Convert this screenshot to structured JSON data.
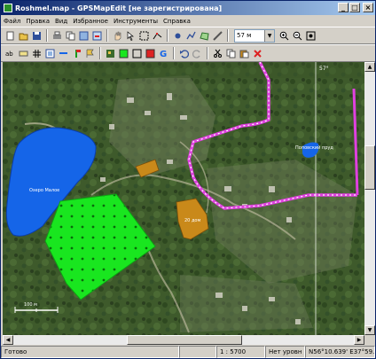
{
  "window": {
    "title": "Roshmel.map - GPSMapEdit [не зарегистрирована]"
  },
  "titlebar_buttons": {
    "minimize": "_",
    "maximize": "□",
    "close": "×"
  },
  "menu": [
    "Файл",
    "Правка",
    "Вид",
    "Избранное",
    "Инструменты",
    "Справка"
  ],
  "toolbar": {
    "zoom_value": "57 м"
  },
  "map": {
    "labels": {
      "lake_west": "Озеро Малое",
      "lake_east": "Поповский пруд",
      "parcel": "20 дом",
      "grid_label": "57°",
      "scale": "100 м"
    }
  },
  "status": {
    "ready": "Готово",
    "scale": "1 : 5700",
    "level": "Нет уровн",
    "coords": "N56°10.639' E37°59.108'"
  },
  "colors": {
    "title_start": "#0a246a",
    "lake": "#1565e8",
    "grid_polygon": "#19e61f",
    "parcel": "#c9891a",
    "track": "#e040e0"
  },
  "icons": [
    "new-icon",
    "open-icon",
    "save-icon",
    "print-icon",
    "copy-map-icon",
    "import-icon",
    "export-icon",
    "undo-icon",
    "hand-icon",
    "select-icon",
    "select-rect-icon",
    "edit-nodes-icon",
    "draw-point-icon",
    "draw-line-icon",
    "draw-polygon-icon",
    "measure-icon",
    "zoom-in-icon",
    "zoom-out-icon",
    "zoom-all-icon"
  ]
}
